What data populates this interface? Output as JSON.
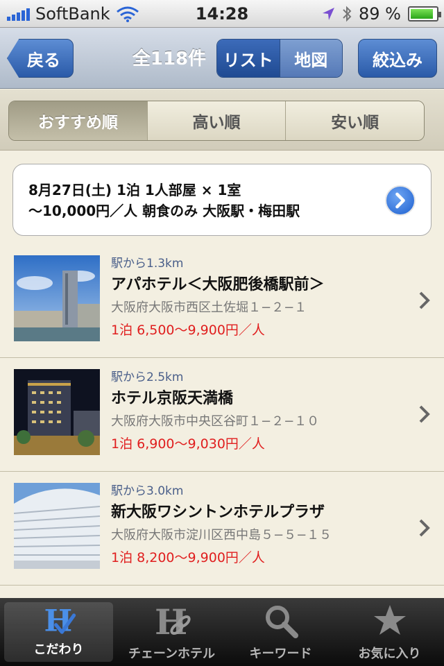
{
  "status": {
    "carrier": "SoftBank",
    "time": "14:28",
    "battery": "89 %",
    "battery_level": 0.89
  },
  "nav": {
    "back_label": "戻る",
    "count_label": "全118件",
    "seg_list": "リスト",
    "seg_map": "地図",
    "filter_label": "絞込み"
  },
  "sort": {
    "recommended": "おすすめ順",
    "high": "高い順",
    "low": "安い順"
  },
  "condition": {
    "line1": "8月27日(土)  1泊  1人部屋 × 1室",
    "line2": "〜10,000円／人  朝食のみ  大阪駅・梅田駅"
  },
  "hotels": [
    {
      "distance": "駅から1.3km",
      "name": "アパホテル＜大阪肥後橋駅前＞",
      "address": "大阪府大阪市西区土佐堀１−２−１",
      "price": "1泊 6,500〜9,900円／人"
    },
    {
      "distance": "駅から2.5km",
      "name": "ホテル京阪天満橋",
      "address": "大阪府大阪市中央区谷町１−２−１０",
      "price": "1泊 6,900〜9,030円／人"
    },
    {
      "distance": "駅から3.0km",
      "name": "新大阪ワシントンホテルプラザ",
      "address": "大阪府大阪市淀川区西中島５−５−１５",
      "price": "1泊 8,200〜9,900円／人"
    }
  ],
  "tabs": {
    "kodawari": "こだわり",
    "chain": "チェーンホテル",
    "keyword": "キーワード",
    "favorites": "お気に入り"
  },
  "colors": {
    "accent": "#2a5aa8",
    "price": "#e01e1e"
  }
}
